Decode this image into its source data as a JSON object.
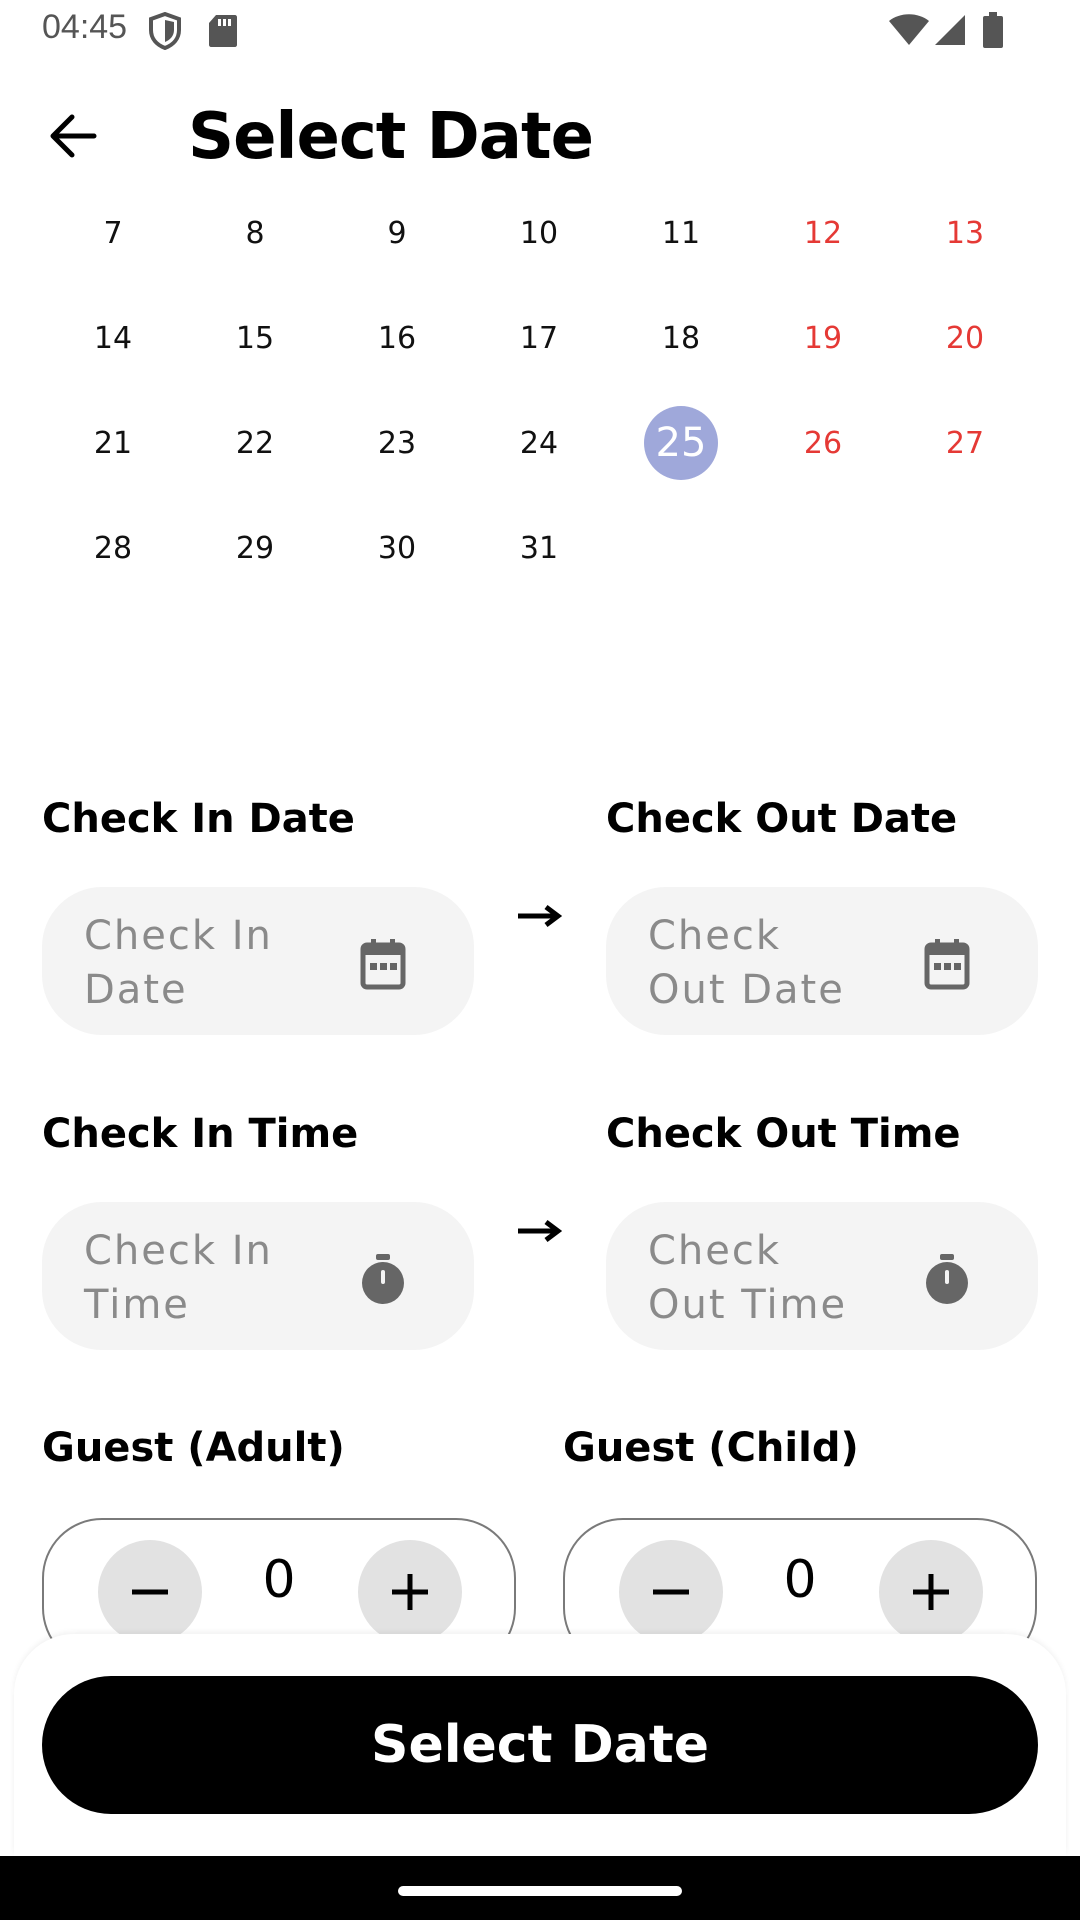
{
  "status_bar": {
    "time": "04:45",
    "icons": [
      "shield-icon",
      "sd-card-icon",
      "wifi-icon",
      "signal-icon",
      "battery-icon"
    ]
  },
  "header": {
    "title": "Select Date",
    "back_icon": "arrow-left-icon"
  },
  "calendar": {
    "weeks": [
      [
        "7",
        "8",
        "9",
        "10",
        "11",
        "12",
        "13"
      ],
      [
        "14",
        "15",
        "16",
        "17",
        "18",
        "19",
        "20"
      ],
      [
        "21",
        "22",
        "23",
        "24",
        "25",
        "26",
        "27"
      ],
      [
        "28",
        "29",
        "30",
        "31",
        "",
        "",
        ""
      ]
    ],
    "selected_day": "25",
    "weekend_color": "#e53935",
    "selected_color": "#9fa8da"
  },
  "check_in_date": {
    "label": "Check In Date",
    "placeholder_line1": "Check In",
    "placeholder_line2": "Date",
    "icon": "calendar-icon"
  },
  "check_out_date": {
    "label": "Check Out Date",
    "placeholder_line1": "Check",
    "placeholder_line2": "Out Date",
    "icon": "calendar-icon"
  },
  "check_in_time": {
    "label": "Check In Time",
    "placeholder_line1": "Check In",
    "placeholder_line2": "Time",
    "icon": "timer-icon"
  },
  "check_out_time": {
    "label": "Check Out Time",
    "placeholder_line1": "Check",
    "placeholder_line2": "Out Time",
    "icon": "timer-icon"
  },
  "guest_adult": {
    "label": "Guest (Adult)",
    "value": "0"
  },
  "guest_child": {
    "label": "Guest (Child)",
    "value": "0"
  },
  "footer": {
    "button_label": "Select Date",
    "button_color": "#000000"
  }
}
